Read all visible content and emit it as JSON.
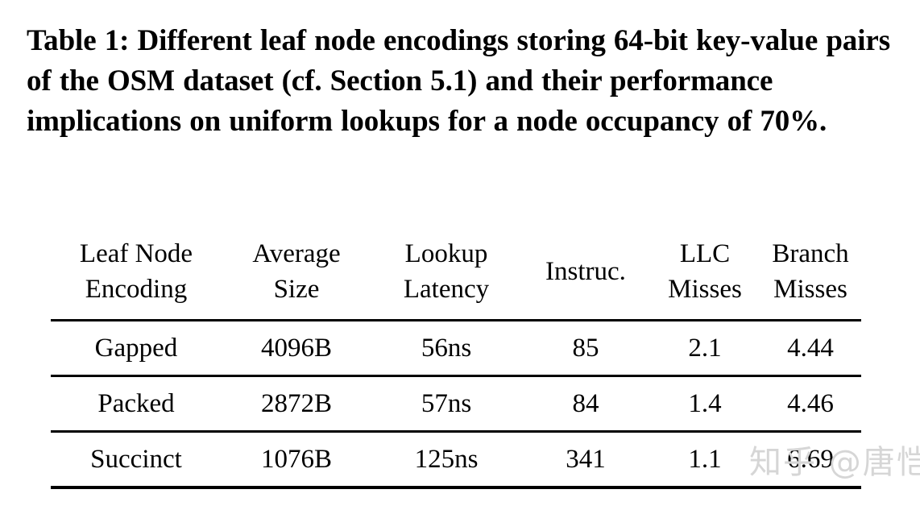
{
  "caption": {
    "text": "Table 1: Different leaf node encodings storing 64-bit key-value pairs of the OSM dataset (cf. Section 5.1) and their performance implications on uniform lookups for a node occupancy of 70%."
  },
  "watermark": {
    "text": "知乎 @唐恺",
    "color": "#d6d6d6"
  },
  "chart_data": {
    "type": "table",
    "title": "Table 1: Different leaf node encodings storing 64-bit key-value pairs of the OSM dataset (cf. Section 5.1) and their performance implications on uniform lookups for a node occupancy of 70%.",
    "columns": [
      {
        "line1": "Leaf Node",
        "line2": "Encoding",
        "full": "Leaf Node Encoding"
      },
      {
        "line1": "Average",
        "line2": "Size",
        "full": "Average Size"
      },
      {
        "line1": "Lookup",
        "line2": "Latency",
        "full": "Lookup Latency"
      },
      {
        "line1": "Instruc.",
        "line2": "",
        "full": "Instruc."
      },
      {
        "line1": "LLC",
        "line2": "Misses",
        "full": "LLC Misses"
      },
      {
        "line1": "Branch",
        "line2": "Misses",
        "full": "Branch Misses"
      }
    ],
    "rows": [
      {
        "cells": [
          "Gapped",
          "4096B",
          "56ns",
          "85",
          "2.1",
          "4.44"
        ]
      },
      {
        "cells": [
          "Packed",
          "2872B",
          "57ns",
          "84",
          "1.4",
          "4.46"
        ]
      },
      {
        "cells": [
          "Succinct",
          "1076B",
          "125ns",
          "341",
          "1.1",
          "6.69"
        ]
      }
    ]
  }
}
